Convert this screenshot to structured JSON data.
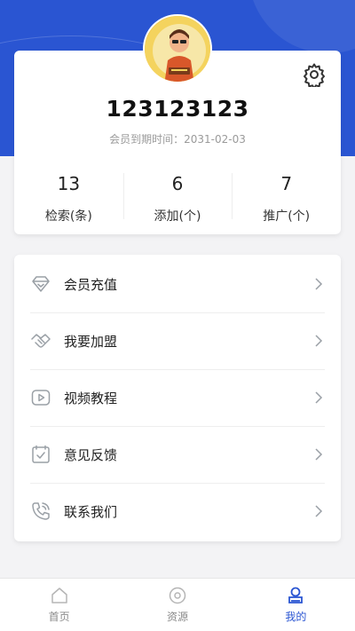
{
  "profile": {
    "username": "123123123",
    "expiry_label": "会员到期时间：",
    "expiry_date": "2031-02-03",
    "avatar_icon": "avatar-illustration"
  },
  "stats": [
    {
      "value": "13",
      "label": "检索(条)"
    },
    {
      "value": "6",
      "label": "添加(个)"
    },
    {
      "value": "7",
      "label": "推广(个)"
    }
  ],
  "menu": [
    {
      "label": "会员充值",
      "icon": "diamond-icon"
    },
    {
      "label": "我要加盟",
      "icon": "handshake-icon"
    },
    {
      "label": "视频教程",
      "icon": "video-icon"
    },
    {
      "label": "意见反馈",
      "icon": "feedback-icon"
    },
    {
      "label": "联系我们",
      "icon": "phone-icon"
    }
  ],
  "tabs": [
    {
      "label": "首页",
      "icon": "home-icon"
    },
    {
      "label": "资源",
      "icon": "resource-icon"
    },
    {
      "label": "我的",
      "icon": "profile-icon",
      "active": true
    }
  ],
  "colors": {
    "accent": "#2a55d2",
    "icon_gray": "#9aa0a6"
  }
}
